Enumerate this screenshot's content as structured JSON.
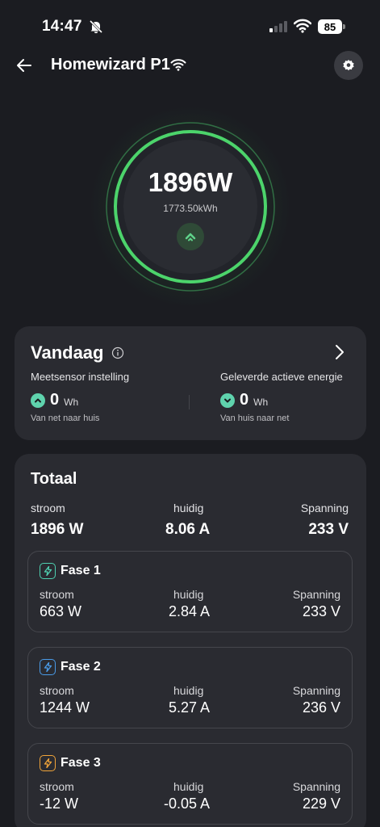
{
  "status_bar": {
    "time": "14:47",
    "battery": "85"
  },
  "header": {
    "title": "Homewizard P1"
  },
  "gauge": {
    "power": "1896W",
    "energy": "1773.50kWh",
    "ring_color": "#4cd46b"
  },
  "today": {
    "title": "Vandaag",
    "left": {
      "label": "Meetsensor instelling",
      "value": "0",
      "unit": "Wh",
      "sub": "Van net naar huis"
    },
    "right": {
      "label": "Geleverde actieve energie",
      "value": "0",
      "unit": "Wh",
      "sub": "Van huis naar net"
    }
  },
  "total": {
    "title": "Totaal",
    "labels": {
      "power": "stroom",
      "current": "huidig",
      "voltage": "Spanning"
    },
    "power": "1896 W",
    "current": "8.06 A",
    "voltage": "233 V"
  },
  "phases": [
    {
      "title": "Fase 1",
      "power": "663 W",
      "current": "2.84 A",
      "voltage": "233 V",
      "color": "#4fd1b1"
    },
    {
      "title": "Fase 2",
      "power": "1244 W",
      "current": "5.27 A",
      "voltage": "236 V",
      "color": "#4a9be8"
    },
    {
      "title": "Fase 3",
      "power": "-12 W",
      "current": "-0.05 A",
      "voltage": "229 V",
      "color": "#f0a43a"
    }
  ],
  "icons": [
    "back-arrow-icon",
    "wifi-icon",
    "settings-icon",
    "info-icon",
    "chevron-right-icon",
    "arrow-up-icon",
    "arrow-down-icon",
    "lightning-icon"
  ]
}
